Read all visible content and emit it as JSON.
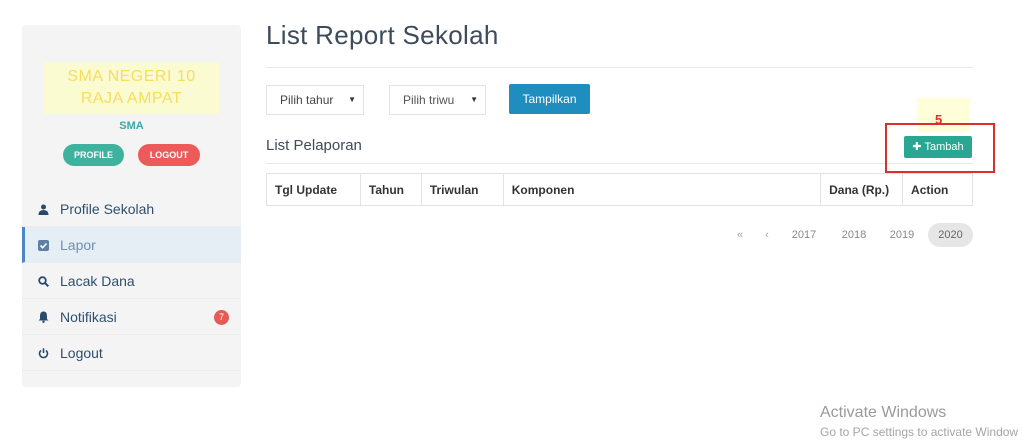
{
  "sidebar": {
    "school_name": "SMA NEGERI 10 RAJA AMPAT",
    "school_type": "SMA",
    "profile_button": "PROFILE",
    "logout_button": "LOGOUT",
    "menu": [
      {
        "label": "Profile Sekolah",
        "icon": "user-icon",
        "active": false
      },
      {
        "label": "Lapor",
        "icon": "check-square-icon",
        "active": true
      },
      {
        "label": "Lacak Dana",
        "icon": "search-icon",
        "active": false
      },
      {
        "label": "Notifikasi",
        "icon": "bell-icon",
        "active": false,
        "badge": "7"
      },
      {
        "label": "Logout",
        "icon": "power-icon",
        "active": false
      }
    ]
  },
  "main": {
    "title": "List Report Sekolah",
    "filter_year": "Pilih tahur",
    "filter_quarter": "Pilih triwu",
    "show_button": "Tampilkan",
    "subtitle": "List Pelaporan",
    "add_button": "Tambah",
    "annotation_number": "5",
    "table_headers": [
      "Tgl Update",
      "Tahun",
      "Triwulan",
      "Komponen",
      "Dana (Rp.)",
      "Action"
    ],
    "pagination": {
      "first": "«",
      "prev": "‹",
      "pages": [
        "2017",
        "2018",
        "2019",
        "2020"
      ],
      "current": "2020"
    }
  },
  "watermark": {
    "line1": "Activate Windows",
    "line2": "Go to PC settings to activate Window"
  },
  "colors": {
    "accent_blue": "#1f8dbe",
    "teal": "#2aa792",
    "danger": "#ed5a5a",
    "annotation_red": "#d92f2f"
  }
}
